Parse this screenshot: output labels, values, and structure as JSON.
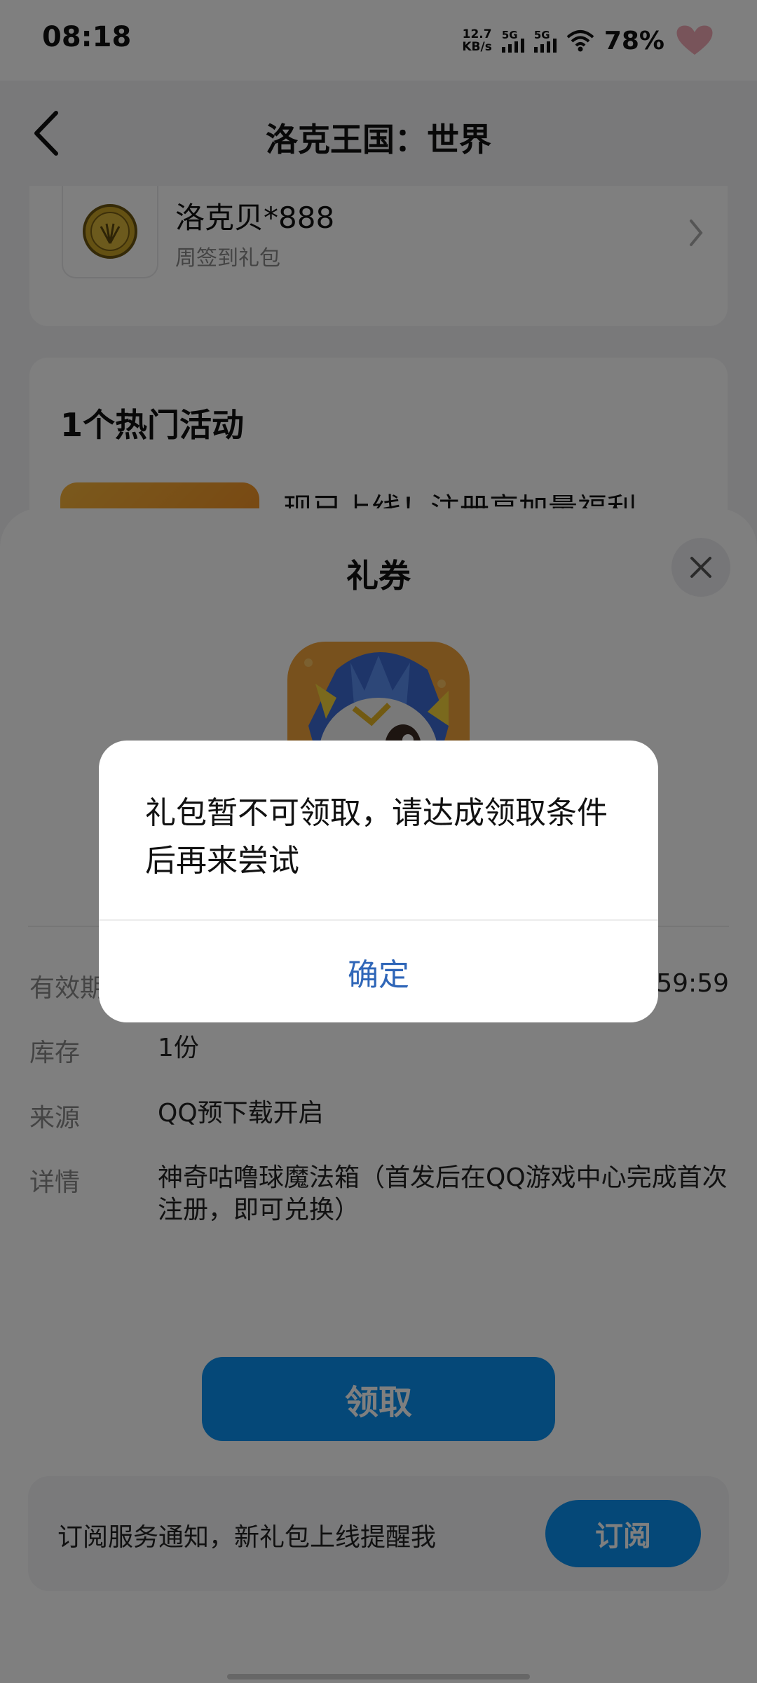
{
  "status_bar": {
    "time": "08:18",
    "net_speed": "12.7",
    "net_speed_unit": "KB/s",
    "sim1": "5G",
    "sim2": "5G",
    "battery": "78%"
  },
  "nav": {
    "title": "洛克王国：世界"
  },
  "gift_item": {
    "name": "洛克贝*888",
    "subtitle": "周签到礼包"
  },
  "activity": {
    "title": "1个热门活动",
    "item_text": "现已上线！注册享加量福利"
  },
  "sheet": {
    "title": "礼券",
    "details": [
      {
        "label": "有效期",
        "value": "59:59"
      },
      {
        "label": "库存",
        "value": "1份"
      },
      {
        "label": "来源",
        "value": "QQ预下载开启"
      },
      {
        "label": "详情",
        "value": "神奇咕噜球魔法箱（首发后在QQ游戏中心完成首次注册，即可兑换）"
      }
    ],
    "claim_button": "领取",
    "subscribe_text": "订阅服务通知，新礼包上线提醒我",
    "subscribe_button": "订阅"
  },
  "dialog": {
    "message": "礼包暂不可领取，请达成领取条件后再来尝试",
    "ok_button": "确定"
  },
  "colors": {
    "accent": "#0a91f0",
    "dialog_link": "#2f66b8",
    "overlay": "rgba(0,0,0,0.5)"
  }
}
